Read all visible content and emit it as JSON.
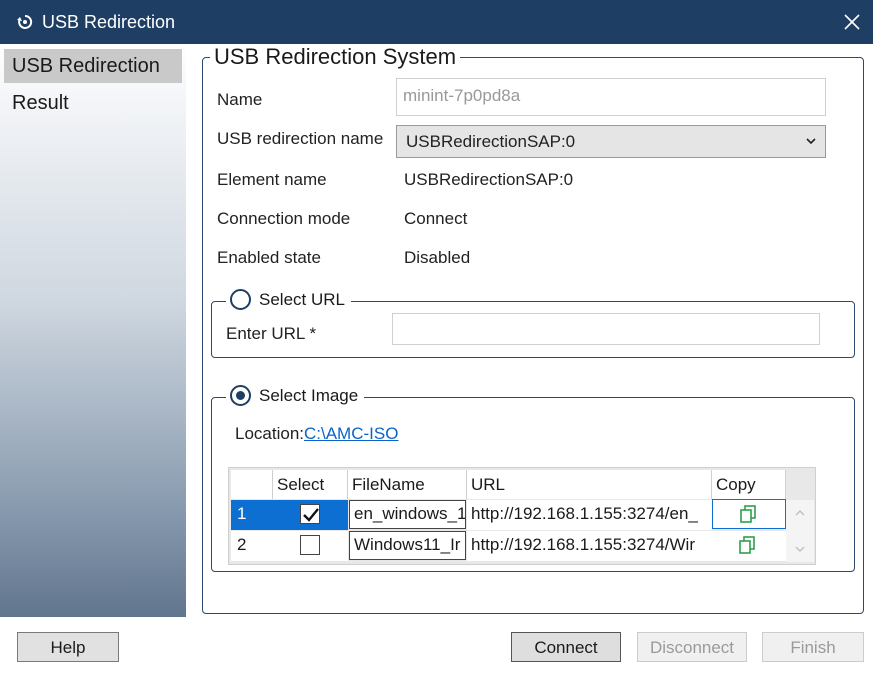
{
  "window": {
    "title": "USB Redirection"
  },
  "sidebar": {
    "items": [
      {
        "label": "USB Redirection"
      },
      {
        "label": "Result"
      }
    ]
  },
  "system": {
    "legend": "USB Redirection System",
    "fields": {
      "name_label": "Name",
      "name_value": "minint-7p0pd8a",
      "usb_name_label": "USB redirection name",
      "usb_name_value": "USBRedirectionSAP:0",
      "element_label": "Element name",
      "element_value": "USBRedirectionSAP:0",
      "connection_label": "Connection mode",
      "connection_value": "Connect",
      "enabled_label": "Enabled state",
      "enabled_value": "Disabled"
    }
  },
  "select_url": {
    "legend": "Select URL",
    "enter_label": "Enter URL *",
    "url_value": ""
  },
  "select_image": {
    "legend": "Select Image",
    "location_label": "Location:",
    "location_path": "C:\\AMC-ISO",
    "table": {
      "headers": [
        "Select",
        "FileName",
        "URL",
        "Copy"
      ],
      "rows": [
        {
          "num": "1",
          "checked": true,
          "filename": "en_windows_1",
          "url": "http://192.168.1.155:3274/en_"
        },
        {
          "num": "2",
          "checked": false,
          "filename": "Windows11_Ir",
          "url": "http://192.168.1.155:3274/Wir"
        }
      ]
    }
  },
  "buttons": {
    "help": "Help",
    "connect": "Connect",
    "disconnect": "Disconnect",
    "finish": "Finish"
  },
  "colors": {
    "titlebar": "#1e3e63",
    "selection": "#0d6fd1",
    "link": "#0a64c8",
    "copy_icon": "#2e9e4e"
  }
}
